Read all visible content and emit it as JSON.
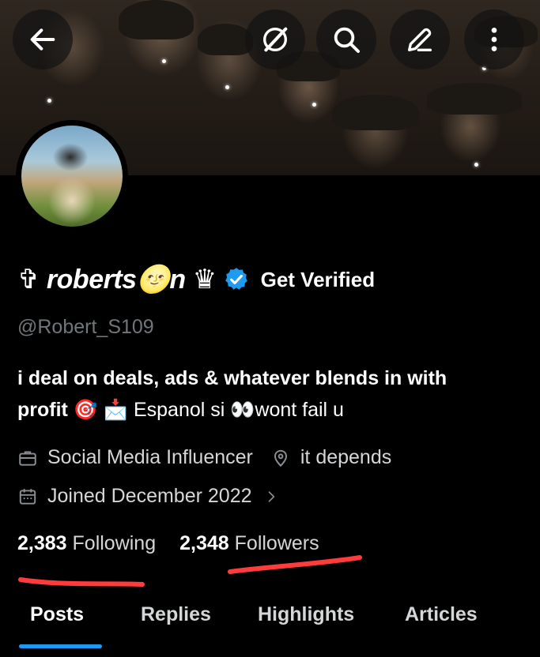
{
  "profile": {
    "display_name": "✞ roberts🌝n ♛",
    "get_verified": "Get Verified",
    "handle": "@Robert_S109",
    "bio_line1": "i deal on deals, ads &  whatever blends in with",
    "bio_line2_bold": "profit",
    "bio_line2_rest": " 🎯 📩 Espanol si        👀wont fail u",
    "occupation": "Social Media Influencer",
    "location": "it depends",
    "joined": "Joined December 2022",
    "following_count": "2,383",
    "following_label": "Following",
    "followers_count": "2,348",
    "followers_label": "Followers"
  },
  "header_icons": [
    "back-arrow-icon",
    "grok-icon",
    "search-icon",
    "edit-icon",
    "more-vertical-icon"
  ],
  "tabs": [
    {
      "label": "Posts",
      "active": true
    },
    {
      "label": "Replies",
      "active": false
    },
    {
      "label": "Highlights",
      "active": false
    },
    {
      "label": "Articles",
      "active": false
    }
  ],
  "colors": {
    "background": "#000000",
    "accent": "#1d9bf0",
    "verified": "#1d9bf0",
    "annotation": "#ff3b3b",
    "muted_text": "#71767b"
  }
}
